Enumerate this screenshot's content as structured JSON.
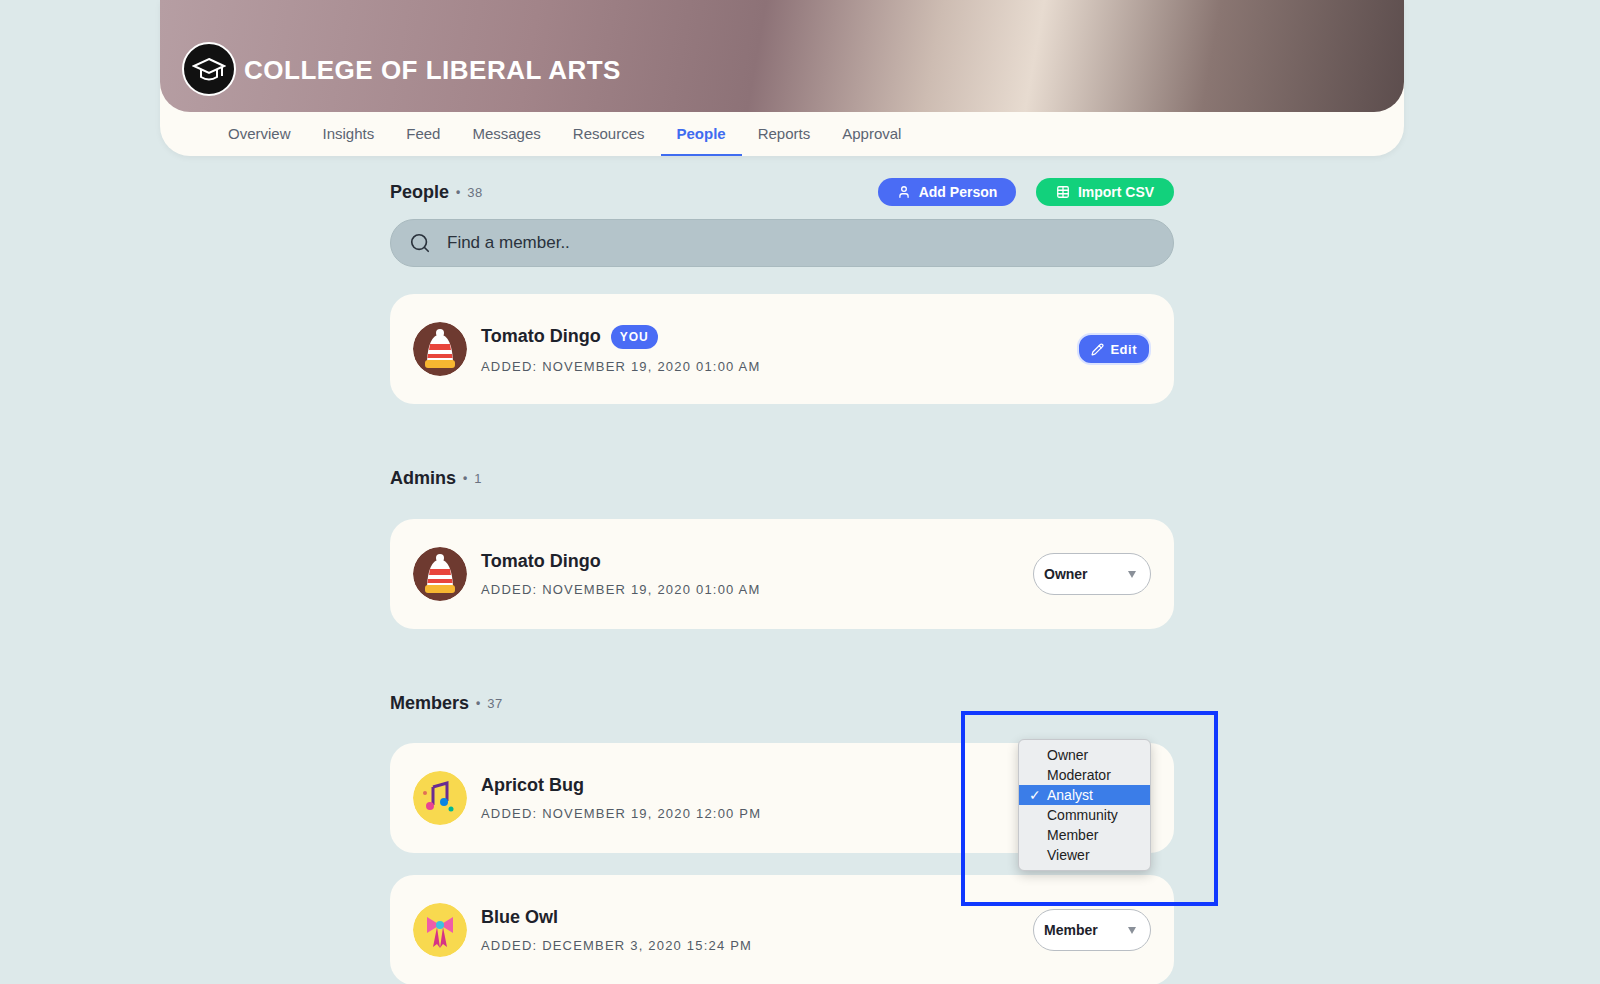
{
  "header": {
    "title": "COLLEGE OF LIBERAL ARTS"
  },
  "tabs": [
    {
      "label": "Overview",
      "selected": false
    },
    {
      "label": "Insights",
      "selected": false
    },
    {
      "label": "Feed",
      "selected": false
    },
    {
      "label": "Messages",
      "selected": false
    },
    {
      "label": "Resources",
      "selected": false
    },
    {
      "label": "People",
      "selected": true
    },
    {
      "label": "Reports",
      "selected": false
    },
    {
      "label": "Approval",
      "selected": false
    }
  ],
  "people": {
    "title": "People",
    "separator": "•",
    "count": "38",
    "buttons": [
      {
        "label": "Add Person",
        "kind": "primary"
      },
      {
        "label": "Import CSV",
        "kind": "import"
      }
    ]
  },
  "search": {
    "placeholder": "Find a member.."
  },
  "me": {
    "name": "Tomato Dingo",
    "badge": "YOU",
    "added": "ADDED: NOVEMBER 19, 2020 01:00 AM",
    "action": "Edit"
  },
  "admins": {
    "title": "Admins",
    "count": "1",
    "rows": [
      {
        "name": "Tomato Dingo",
        "added": "ADDED: NOVEMBER 19, 2020 01:00 AM",
        "role": "Owner",
        "menu_open": false
      }
    ]
  },
  "members": {
    "title": "Members",
    "count": "37",
    "rows": [
      {
        "name": "Apricot Bug",
        "added": "ADDED: NOVEMBER 19, 2020 12:00 PM",
        "role": "Analyst",
        "menu_open": true
      },
      {
        "name": "Blue Owl",
        "added": "ADDED: DECEMBER 3, 2020 15:24 PM",
        "role": "Member",
        "menu_open": false
      }
    ]
  },
  "role_menu": {
    "check": "✓",
    "options": [
      {
        "label": "Owner",
        "selected": false
      },
      {
        "label": "Moderator",
        "selected": false
      },
      {
        "label": "Analyst",
        "selected": true
      },
      {
        "label": "Community",
        "selected": false
      },
      {
        "label": "Member",
        "selected": false
      },
      {
        "label": "Viewer",
        "selected": false
      }
    ]
  },
  "annotation": {
    "shown": true
  }
}
